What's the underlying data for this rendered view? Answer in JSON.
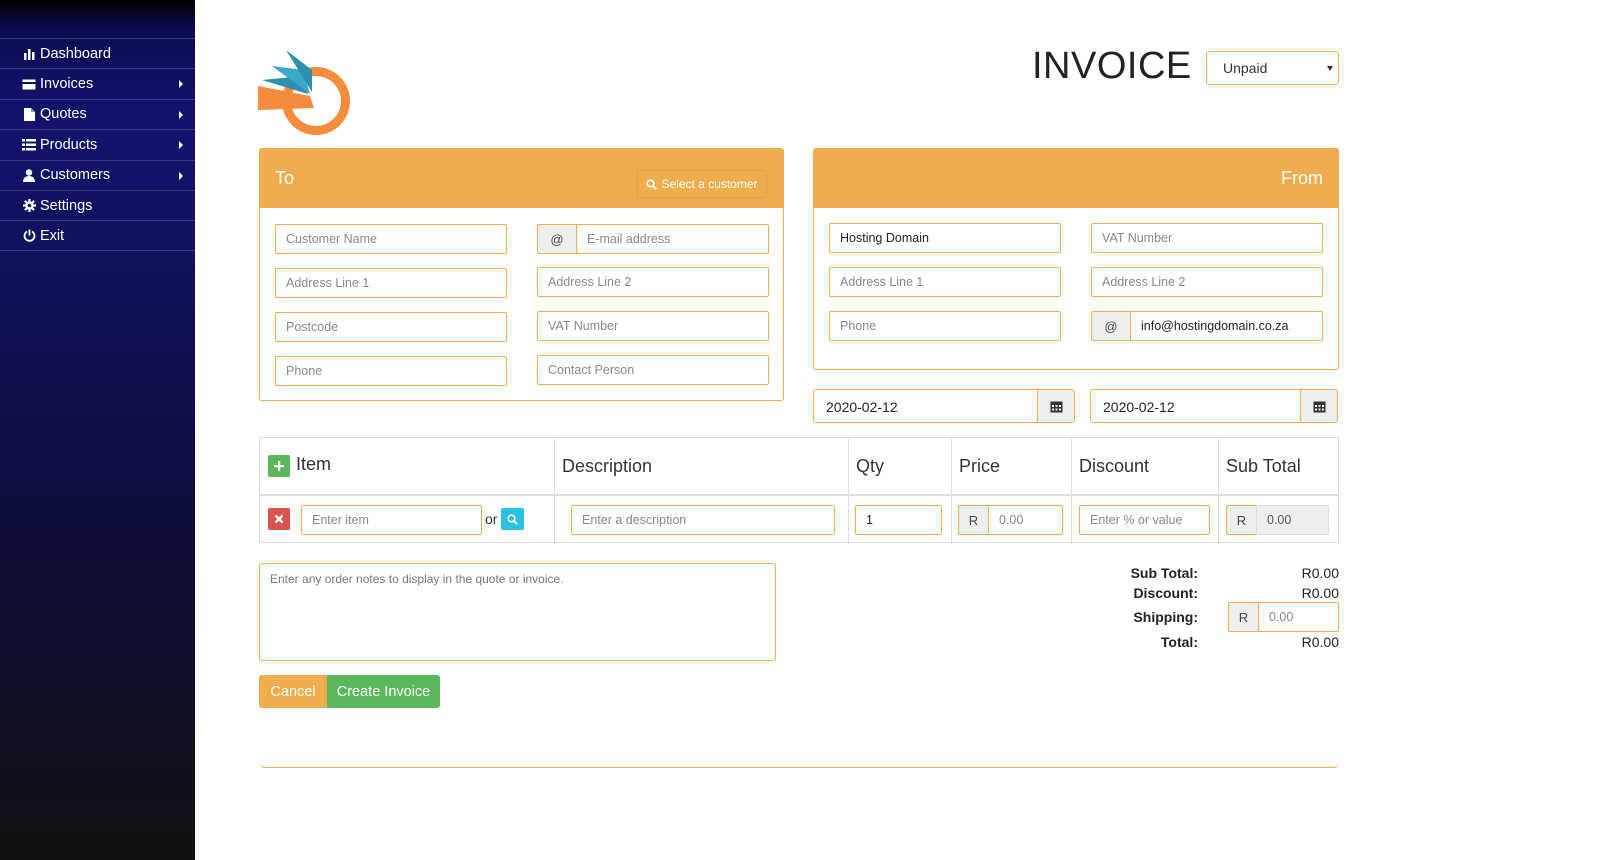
{
  "sidebar": {
    "items": [
      {
        "label": "Dashboard",
        "icon": "bar-chart-icon"
      },
      {
        "label": "Invoices",
        "icon": "credit-card-icon"
      },
      {
        "label": "Quotes",
        "icon": "file-icon"
      },
      {
        "label": "Products",
        "icon": "list-icon"
      },
      {
        "label": "Customers",
        "icon": "user-icon"
      },
      {
        "label": "Settings",
        "icon": "gear-icon"
      },
      {
        "label": "Exit",
        "icon": "power-icon"
      }
    ]
  },
  "header": {
    "title": "INVOICE",
    "status_value": "Unpaid"
  },
  "to_panel": {
    "title": "To",
    "select_customer_label": "Select a customer",
    "customer_name_placeholder": "Customer Name",
    "email_addon": "@",
    "email_placeholder": "E-mail address",
    "address1_placeholder": "Address Line 1",
    "address2_placeholder": "Address Line 2",
    "postcode_placeholder": "Postcode",
    "vat_placeholder": "VAT Number",
    "phone_placeholder": "Phone",
    "contact_placeholder": "Contact Person"
  },
  "from_panel": {
    "title": "From",
    "company_value": "Hosting Domain",
    "vat_placeholder": "VAT Number",
    "address1_placeholder": "Address Line 1",
    "address2_placeholder": "Address Line 2",
    "phone_placeholder": "Phone",
    "email_addon": "@",
    "email_value": "info@hostingdomain.co.za"
  },
  "dates": {
    "invoice_date": "2020-02-12",
    "due_date": "2020-02-12"
  },
  "items_table": {
    "headers": [
      "Item",
      "Description",
      "Qty",
      "Price",
      "Discount",
      "Sub Total"
    ],
    "row": {
      "item_placeholder": "Enter item",
      "or_label": "or",
      "description_placeholder": "Enter a description",
      "qty_value": "1",
      "currency": "R",
      "price_value": "0.00",
      "discount_placeholder": "Enter % or value",
      "subtotal_value": "0.00"
    }
  },
  "notes": {
    "placeholder": "Enter any order notes to display in the quote or invoice."
  },
  "totals": {
    "subtotal_label": "Sub Total:",
    "subtotal_value": "R0.00",
    "discount_label": "Discount:",
    "discount_value": "R0.00",
    "shipping_label": "Shipping:",
    "shipping_currency": "R",
    "shipping_value": "0.00",
    "total_label": "Total:",
    "total_value": "R0.00"
  },
  "actions": {
    "cancel_label": "Cancel",
    "create_label": "Create Invoice"
  },
  "colors": {
    "accent": "#f0ad4e",
    "success": "#5cb85c",
    "danger": "#d9534f",
    "info": "#2bc0e4",
    "logo_orange": "#f58b3c",
    "logo_teal": "#2f8fb0"
  }
}
